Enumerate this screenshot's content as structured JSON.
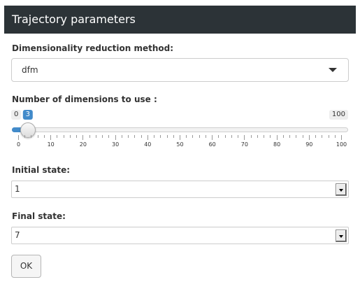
{
  "panel": {
    "title": "Trajectory parameters"
  },
  "reduction": {
    "label": "Dimensionality reduction method:",
    "value": "dfm",
    "caret_icon": "caret-down-icon"
  },
  "dimensions": {
    "label": "Number of dimensions to use :",
    "min": 0,
    "max": 100,
    "value": 3,
    "min_label": "0",
    "max_label": "100",
    "value_label": "3",
    "fill_color": "#428bca",
    "tick_labels": [
      "0",
      "10",
      "20",
      "30",
      "40",
      "50",
      "60",
      "70",
      "80",
      "90",
      "100"
    ]
  },
  "initial_state": {
    "label": "Initial state:",
    "value": "1",
    "arrow_icon": "dropdown-arrow-icon"
  },
  "final_state": {
    "label": "Final state:",
    "value": "7",
    "arrow_icon": "dropdown-arrow-icon"
  },
  "ok_button": {
    "label": "OK"
  },
  "colors": {
    "header_bg": "#2c3337",
    "accent": "#428bca"
  }
}
